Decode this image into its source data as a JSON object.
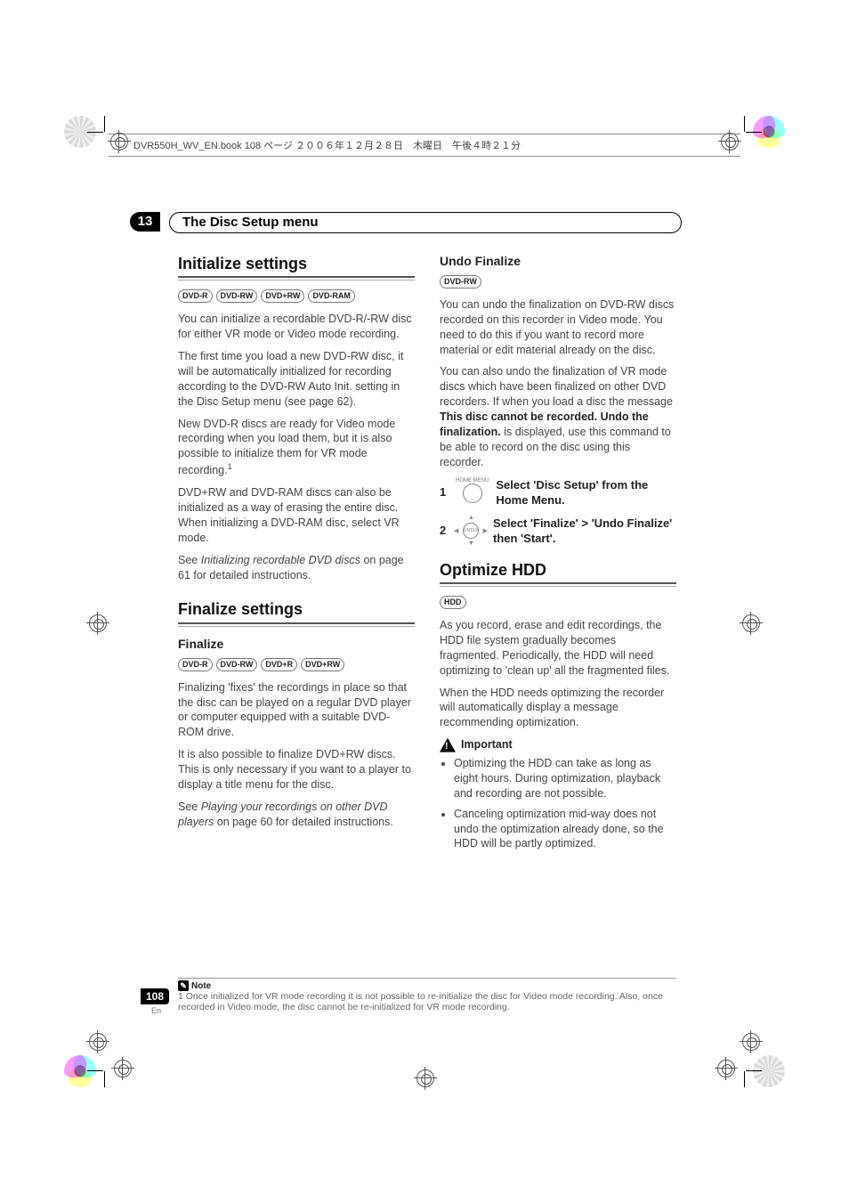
{
  "header_strip": "DVR550H_WV_EN.book  108 ページ  ２００６年１２月２８日　木曜日　午後４時２１分",
  "chapter_num": "13",
  "chapter_title": "The Disc Setup menu",
  "page_number": "108",
  "lang": "En",
  "left": {
    "h_init": "Initialize settings",
    "badges_init": [
      "DVD-R",
      "DVD-RW",
      "DVD+RW",
      "DVD-RAM"
    ],
    "p1": "You can initialize a recordable DVD-R/-RW disc for either VR mode or Video mode recording.",
    "p2": "The first time you load a new DVD-RW disc, it will be automatically initialized for recording according to the DVD-RW Auto Init. setting in the Disc Setup menu (see page 62).",
    "p3a": "New DVD-R discs are ready for Video mode recording when you load them, but it is also possible to initialize them for VR mode recording.",
    "p4": "DVD+RW and DVD-RAM discs can also be initialized as a way of erasing the entire disc. When initializing a DVD-RAM disc, select VR mode.",
    "p5a": "See ",
    "p5i": "Initializing recordable DVD discs",
    "p5b": " on page 61 for detailed instructions.",
    "h_fin": "Finalize settings",
    "sub_fin": "Finalize",
    "badges_fin": [
      "DVD-R",
      "DVD-RW",
      "DVD+R",
      "DVD+RW"
    ],
    "f1": "Finalizing 'fixes' the recordings in place so that the disc can be played on a regular DVD player or computer equipped with a suitable DVD-ROM drive.",
    "f2": "It is also possible to finalize DVD+RW discs. This is only necessary if you want to a player to display a title menu for the disc.",
    "f3a": "See ",
    "f3i": "Playing your recordings on other DVD players",
    "f3b": " on page 60 for detailed instructions."
  },
  "right": {
    "sub_undo": "Undo Finalize",
    "badges_undo": [
      "DVD-RW"
    ],
    "u1": "You can undo the finalization on DVD-RW discs recorded on this recorder in Video mode. You need to do this if you want to record more material or edit material already on the disc.",
    "u2a": "You can also undo the finalization of VR mode discs which have been finalized on other DVD recorders. If when you load a disc the message ",
    "u2b": "This disc cannot be recorded. Undo the finalization.",
    "u2c": " is displayed, use this command to be able to record on the disc using this recorder.",
    "home_menu_label": "HOME MENU",
    "step1": "Select 'Disc Setup' from the Home Menu.",
    "enter_label": "ENTER",
    "step2": "Select 'Finalize' > 'Undo Finalize' then 'Start'.",
    "h_opt": "Optimize HDD",
    "badges_opt": [
      "HDD"
    ],
    "o1": "As you record, erase and edit recordings, the HDD file system gradually becomes fragmented. Periodically, the HDD will need optimizing to 'clean up' all the fragmented files.",
    "o2": "When the HDD needs optimizing the recorder will automatically display a message recommending optimization.",
    "important": "Important",
    "b1": "Optimizing the HDD can take as long as eight hours. During optimization, playback and recording are not possible.",
    "b2": "Canceling optimization mid-way does not undo the optimization already done, so the HDD will be partly optimized."
  },
  "note": {
    "label": "Note",
    "text": "1 Once initialized for VR mode recording it is not possible to re-initialize the disc for Video mode recording. Also, once recorded in Video mode, the disc cannot be re-initialized for VR mode recording."
  }
}
